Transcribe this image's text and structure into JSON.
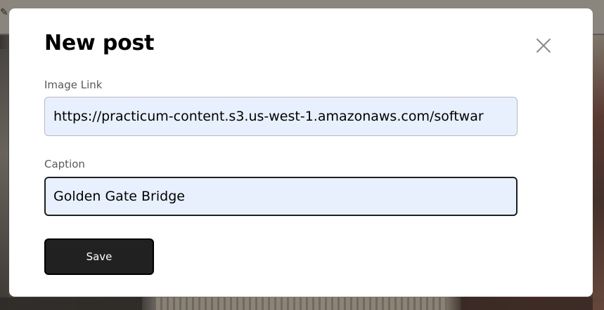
{
  "modal": {
    "title": "New post",
    "close_icon": "close-icon",
    "fields": {
      "image_link": {
        "label": "Image Link",
        "value": "https://practicum-content.s3.us-west-1.amazonaws.com/softwar"
      },
      "caption": {
        "label": "Caption",
        "value": "Golden Gate Bridge"
      }
    },
    "save_label": "Save"
  },
  "colors": {
    "modal_background": "#ffffff",
    "input_background": "#e8f0fe",
    "button_background": "#212121",
    "button_text": "#ffffff",
    "label_text": "#595959",
    "close_icon": "#8a8a8a"
  }
}
